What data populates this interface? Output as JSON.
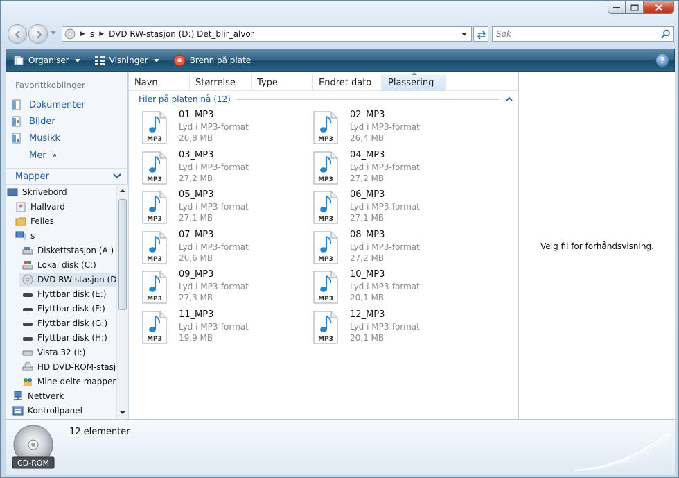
{
  "window": {
    "caption_buttons": [
      "minimize-icon",
      "maximize-icon",
      "close-icon"
    ]
  },
  "address": {
    "crumbs": [
      "s",
      "DVD RW-stasjon (D:) Det_blir_alvor"
    ],
    "search_placeholder": "Søk"
  },
  "toolbar": {
    "organize": "Organiser",
    "views": "Visninger",
    "burn": "Brenn på plate",
    "help": "?"
  },
  "favorites": {
    "title": "Favorittkoblinger",
    "items": [
      "Dokumenter",
      "Bilder",
      "Musikk",
      "Mer"
    ]
  },
  "folders": {
    "title": "Mapper",
    "tree": [
      "Skrivebord",
      "Hallvard",
      "Felles",
      "s",
      "Diskettstasjon (A:)",
      "Lokal disk (C:)",
      "DVD RW-stasjon (D:)",
      "Flyttbar disk (E:)",
      "Flyttbar disk (F:)",
      "Flyttbar disk (G:)",
      "Flyttbar disk (H:)",
      "Vista 32 (I:)",
      "HD DVD-ROM-stasjon",
      "Mine delte mapper",
      "Nettverk",
      "Kontrollpanel"
    ]
  },
  "columns": [
    "Navn",
    "Størrelse",
    "Type",
    "Endret dato",
    "Plassering"
  ],
  "group_label": "Filer på platen nå (12)",
  "files": [
    {
      "name": "01_MP3",
      "type": "Lyd i MP3-format",
      "size": "26,8 MB"
    },
    {
      "name": "02_MP3",
      "type": "Lyd i MP3-format",
      "size": "26,4 MB"
    },
    {
      "name": "03_MP3",
      "type": "Lyd i MP3-format",
      "size": "27,2 MB"
    },
    {
      "name": "04_MP3",
      "type": "Lyd i MP3-format",
      "size": "27,2 MB"
    },
    {
      "name": "05_MP3",
      "type": "Lyd i MP3-format",
      "size": "27,1 MB"
    },
    {
      "name": "06_MP3",
      "type": "Lyd i MP3-format",
      "size": "27,1 MB"
    },
    {
      "name": "07_MP3",
      "type": "Lyd i MP3-format",
      "size": "26,6 MB"
    },
    {
      "name": "08_MP3",
      "type": "Lyd i MP3-format",
      "size": "27,2 MB"
    },
    {
      "name": "09_MP3",
      "type": "Lyd i MP3-format",
      "size": "27,3 MB"
    },
    {
      "name": "10_MP3",
      "type": "Lyd i MP3-format",
      "size": "20,1 MB"
    },
    {
      "name": "11_MP3",
      "type": "Lyd i MP3-format",
      "size": "19,9 MB"
    },
    {
      "name": "12_MP3",
      "type": "Lyd i MP3-format",
      "size": "20,1 MB"
    }
  ],
  "file_icon_label": "MP3",
  "preview_text": "Velg fil for forhåndsvisning.",
  "details": {
    "count": "12 elementer",
    "drive_label": "CD-ROM"
  },
  "colors": {
    "toolbar": "#2f5f7f",
    "link": "#1a5aa6",
    "music_note": "#2a86c8"
  }
}
